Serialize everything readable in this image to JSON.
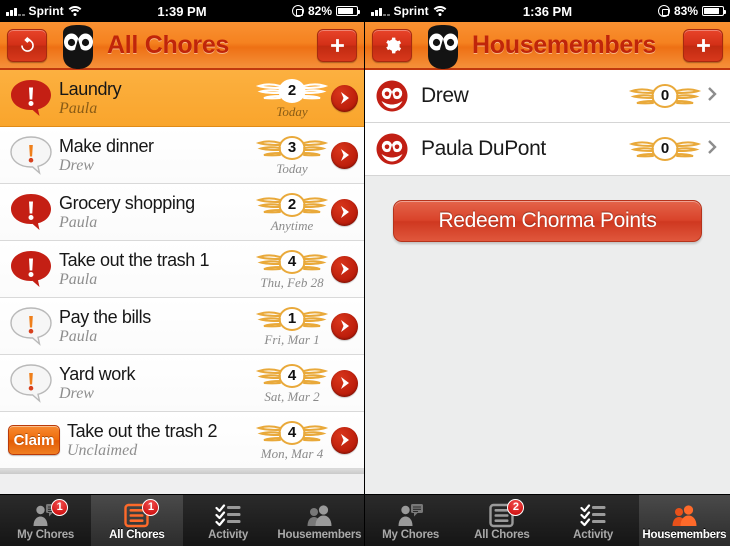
{
  "left": {
    "status_bar": {
      "carrier": "Sprint",
      "time": "1:39 PM",
      "battery_percent": "82%",
      "signal_icon": "signal-bars-icon",
      "wifi_icon": "wifi-icon",
      "rotation_lock_icon": "rotation-lock-icon",
      "battery_icon": "battery-icon"
    },
    "nav": {
      "left_button_icon": "refresh-icon",
      "logo_icon": "owl-logo-icon",
      "title": "All Chores",
      "right_button_icon": "plus-icon"
    },
    "chores": [
      {
        "title": "Laundry",
        "assignee": "Paula",
        "points": "2",
        "due": "Today",
        "status": "overdue",
        "selected": true,
        "action": "none",
        "status_icon": "alert-bubble-red-icon"
      },
      {
        "title": "Make dinner",
        "assignee": "Drew",
        "points": "3",
        "due": "Today",
        "status": "pending",
        "selected": false,
        "action": "none",
        "status_icon": "alert-bubble-white-icon"
      },
      {
        "title": "Grocery shopping",
        "assignee": "Paula",
        "points": "2",
        "due": "Anytime",
        "status": "overdue",
        "selected": false,
        "action": "none",
        "status_icon": "alert-bubble-red-icon"
      },
      {
        "title": "Take out the trash 1",
        "assignee": "Paula",
        "points": "4",
        "due": "Thu, Feb 28",
        "status": "overdue",
        "selected": false,
        "action": "none",
        "status_icon": "alert-bubble-red-icon"
      },
      {
        "title": "Pay the bills",
        "assignee": "Paula",
        "points": "1",
        "due": "Fri, Mar 1",
        "status": "pending",
        "selected": false,
        "action": "none",
        "status_icon": "alert-bubble-white-icon"
      },
      {
        "title": "Yard work",
        "assignee": "Drew",
        "points": "4",
        "due": "Sat, Mar 2",
        "status": "pending",
        "selected": false,
        "action": "none",
        "status_icon": "alert-bubble-white-icon"
      },
      {
        "title": "Take out the trash 2",
        "assignee": "Unclaimed",
        "points": "4",
        "due": "Mon, Mar 4",
        "status": "unclaimed",
        "selected": false,
        "action": "Claim",
        "status_icon": "claim-button"
      }
    ],
    "tabs": [
      {
        "label": "My Chores",
        "icon": "person-chat-icon",
        "badge": "1",
        "active": false
      },
      {
        "label": "All Chores",
        "icon": "list-icon",
        "badge": "1",
        "active": true
      },
      {
        "label": "Activity",
        "icon": "checklist-icon",
        "badge": null,
        "active": false
      },
      {
        "label": "Housemembers",
        "icon": "people-icon",
        "badge": null,
        "active": false
      }
    ]
  },
  "right": {
    "status_bar": {
      "carrier": "Sprint",
      "time": "1:36 PM",
      "battery_percent": "83%",
      "signal_icon": "signal-bars-icon",
      "wifi_icon": "wifi-icon",
      "rotation_lock_icon": "rotation-lock-icon",
      "battery_icon": "battery-icon"
    },
    "nav": {
      "left_button_icon": "gear-icon",
      "logo_icon": "owl-logo-icon",
      "title": "Housemembers",
      "right_button_icon": "plus-icon"
    },
    "members": [
      {
        "name": "Drew",
        "points": "0",
        "avatar_icon": "owl-avatar-icon"
      },
      {
        "name": "Paula DuPont",
        "points": "0",
        "avatar_icon": "owl-avatar-icon"
      }
    ],
    "redeem_button": "Redeem Chorma Points",
    "tabs": [
      {
        "label": "My Chores",
        "icon": "person-chat-icon",
        "badge": null,
        "active": false
      },
      {
        "label": "All Chores",
        "icon": "list-icon",
        "badge": "2",
        "active": false
      },
      {
        "label": "Activity",
        "icon": "checklist-icon",
        "badge": null,
        "active": false
      },
      {
        "label": "Housemembers",
        "icon": "people-icon",
        "badge": null,
        "active": true
      }
    ]
  },
  "colors": {
    "nav_orange": "#f58220",
    "title_red": "#c0250a",
    "selected_row": "#f9a52c",
    "badge_red": "#cf1111",
    "wing_gold": "#e9a93a"
  }
}
